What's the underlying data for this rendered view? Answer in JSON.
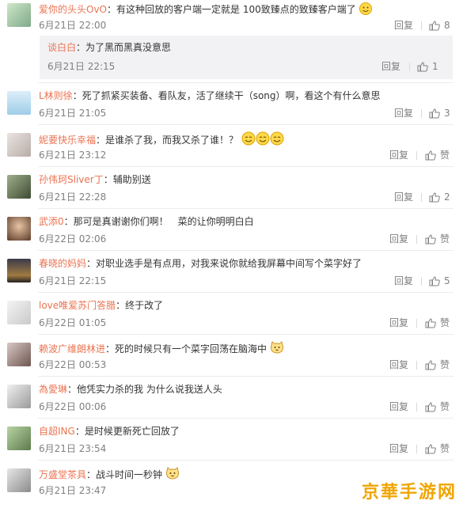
{
  "comments": [
    {
      "user": "爱你的头头OvO",
      "text": "：有这种回放的客户端一定就是 100致臻点的致臻客户端了",
      "time": "6月21日 22:00",
      "reply": "回复",
      "likes": "8",
      "sub": {
        "user": "谈白白",
        "text": "：为了黑而黑真没意思",
        "time": "6月21日 22:15",
        "reply": "回复",
        "likes": "1"
      }
    },
    {
      "user": "L林则徐",
      "text": "：死了抓紧买装备、看队友，活了继续干（song）啊，看这个有什么意思",
      "time": "6月21日 21:05",
      "reply": "回复",
      "likes": "3"
    },
    {
      "user": "妮要快乐幸福",
      "text": "：是谁杀了我，而我又杀了谁！？",
      "time": "6月21日 23:12",
      "reply": "回复",
      "likes": "赞"
    },
    {
      "user": "孙伟珂Sliver丁",
      "text": "：辅助别送",
      "time": "6月21日 22:28",
      "reply": "回复",
      "likes": "2"
    },
    {
      "user": "武添0",
      "text": "：那可是真谢谢你们啊！　菜的让你明明白白",
      "time": "6月22日 02:06",
      "reply": "回复",
      "likes": "赞"
    },
    {
      "user": "春晓的妈妈",
      "text": "：对职业选手是有点用，对我来说你就给我屏幕中间写个菜字好了",
      "time": "6月21日 22:15",
      "reply": "回复",
      "likes": "5"
    },
    {
      "user": "love唯爱苏门答腊",
      "text": "：终于改了",
      "time": "6月22日 01:05",
      "reply": "回复",
      "likes": "赞"
    },
    {
      "user": "赖波广维朗林进",
      "text": "：死的时候只有一个菜字回荡在脑海中",
      "time": "6月22日 00:53",
      "reply": "回复",
      "likes": "赞"
    },
    {
      "user": "為愛琳",
      "text": "：他凭实力杀的我 为什么说我送人头",
      "time": "6月22日 00:06",
      "reply": "回复",
      "likes": "赞"
    },
    {
      "user": "自超ING",
      "text": "：是时候更新死亡回放了",
      "time": "6月21日 23:54",
      "reply": "回复",
      "likes": "赞"
    },
    {
      "user": "万盛堂茶具",
      "text": "：战斗时间一秒钟",
      "time": "6月21日 23:47",
      "reply": "回复",
      "likes": "赞"
    }
  ],
  "icons": {
    "like": "thumbs-up-icon",
    "emoji_smile": "smile-emoji-icon",
    "emoji_cat": "cat-face-emoji-icon"
  },
  "colors": {
    "username": "#eb7350",
    "meta": "#808080",
    "subbox_bg": "#f2f2f5"
  },
  "watermark": "京華手游网"
}
